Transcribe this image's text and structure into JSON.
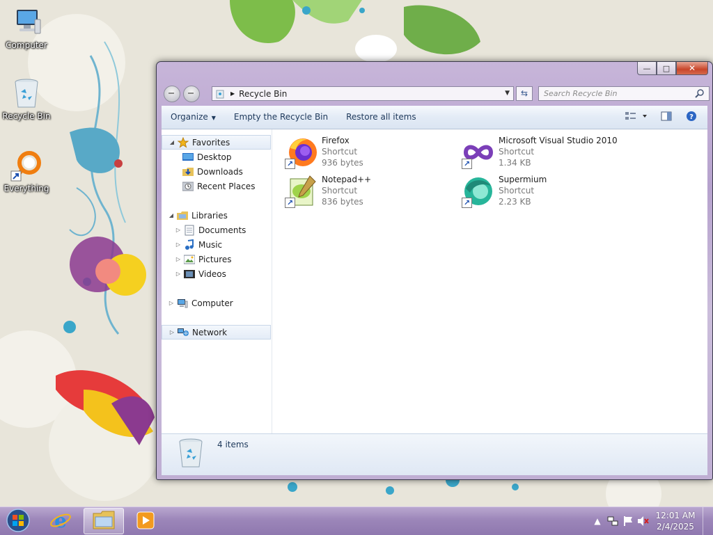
{
  "desktop": {
    "icons": [
      {
        "label": "Computer",
        "icon": "computer-icon"
      },
      {
        "label": "Recycle Bin",
        "icon": "recycle-bin-icon"
      },
      {
        "label": "Everything",
        "icon": "everything-search-icon"
      }
    ]
  },
  "window": {
    "caption_buttons": {
      "minimize": "minimize-icon",
      "maximize": "maximize-icon",
      "close": "close-icon"
    },
    "address": {
      "location": "Recycle Bin"
    },
    "search": {
      "placeholder": "Search Recycle Bin"
    },
    "toolbar": {
      "organize": "Organize",
      "empty": "Empty the Recycle Bin",
      "restore": "Restore all items"
    },
    "nav": {
      "favorites": "Favorites",
      "desktop": "Desktop",
      "downloads": "Downloads",
      "recent": "Recent Places",
      "libraries": "Libraries",
      "documents": "Documents",
      "music": "Music",
      "pictures": "Pictures",
      "videos": "Videos",
      "computer": "Computer",
      "network": "Network"
    },
    "files": [
      {
        "name": "Firefox",
        "type": "Shortcut",
        "size": "936 bytes",
        "icon": "firefox-icon"
      },
      {
        "name": "Microsoft Visual Studio 2010",
        "type": "Shortcut",
        "size": "1.34 KB",
        "icon": "visual-studio-icon"
      },
      {
        "name": "Notepad++",
        "type": "Shortcut",
        "size": "836 bytes",
        "icon": "notepad-plus-plus-icon"
      },
      {
        "name": "Supermium",
        "type": "Shortcut",
        "size": "2.23 KB",
        "icon": "supermium-icon"
      }
    ],
    "details": {
      "count": "4 items"
    }
  },
  "taskbar": {
    "apps": [
      "internet-explorer-icon",
      "windows-explorer-icon",
      "media-player-icon"
    ],
    "clock": {
      "time": "12:01 AM",
      "date": "2/4/2025"
    }
  },
  "colors": {
    "accent": "#1e395b",
    "window_frame": "#b6a2cd",
    "taskbar": "#9c86b9"
  }
}
